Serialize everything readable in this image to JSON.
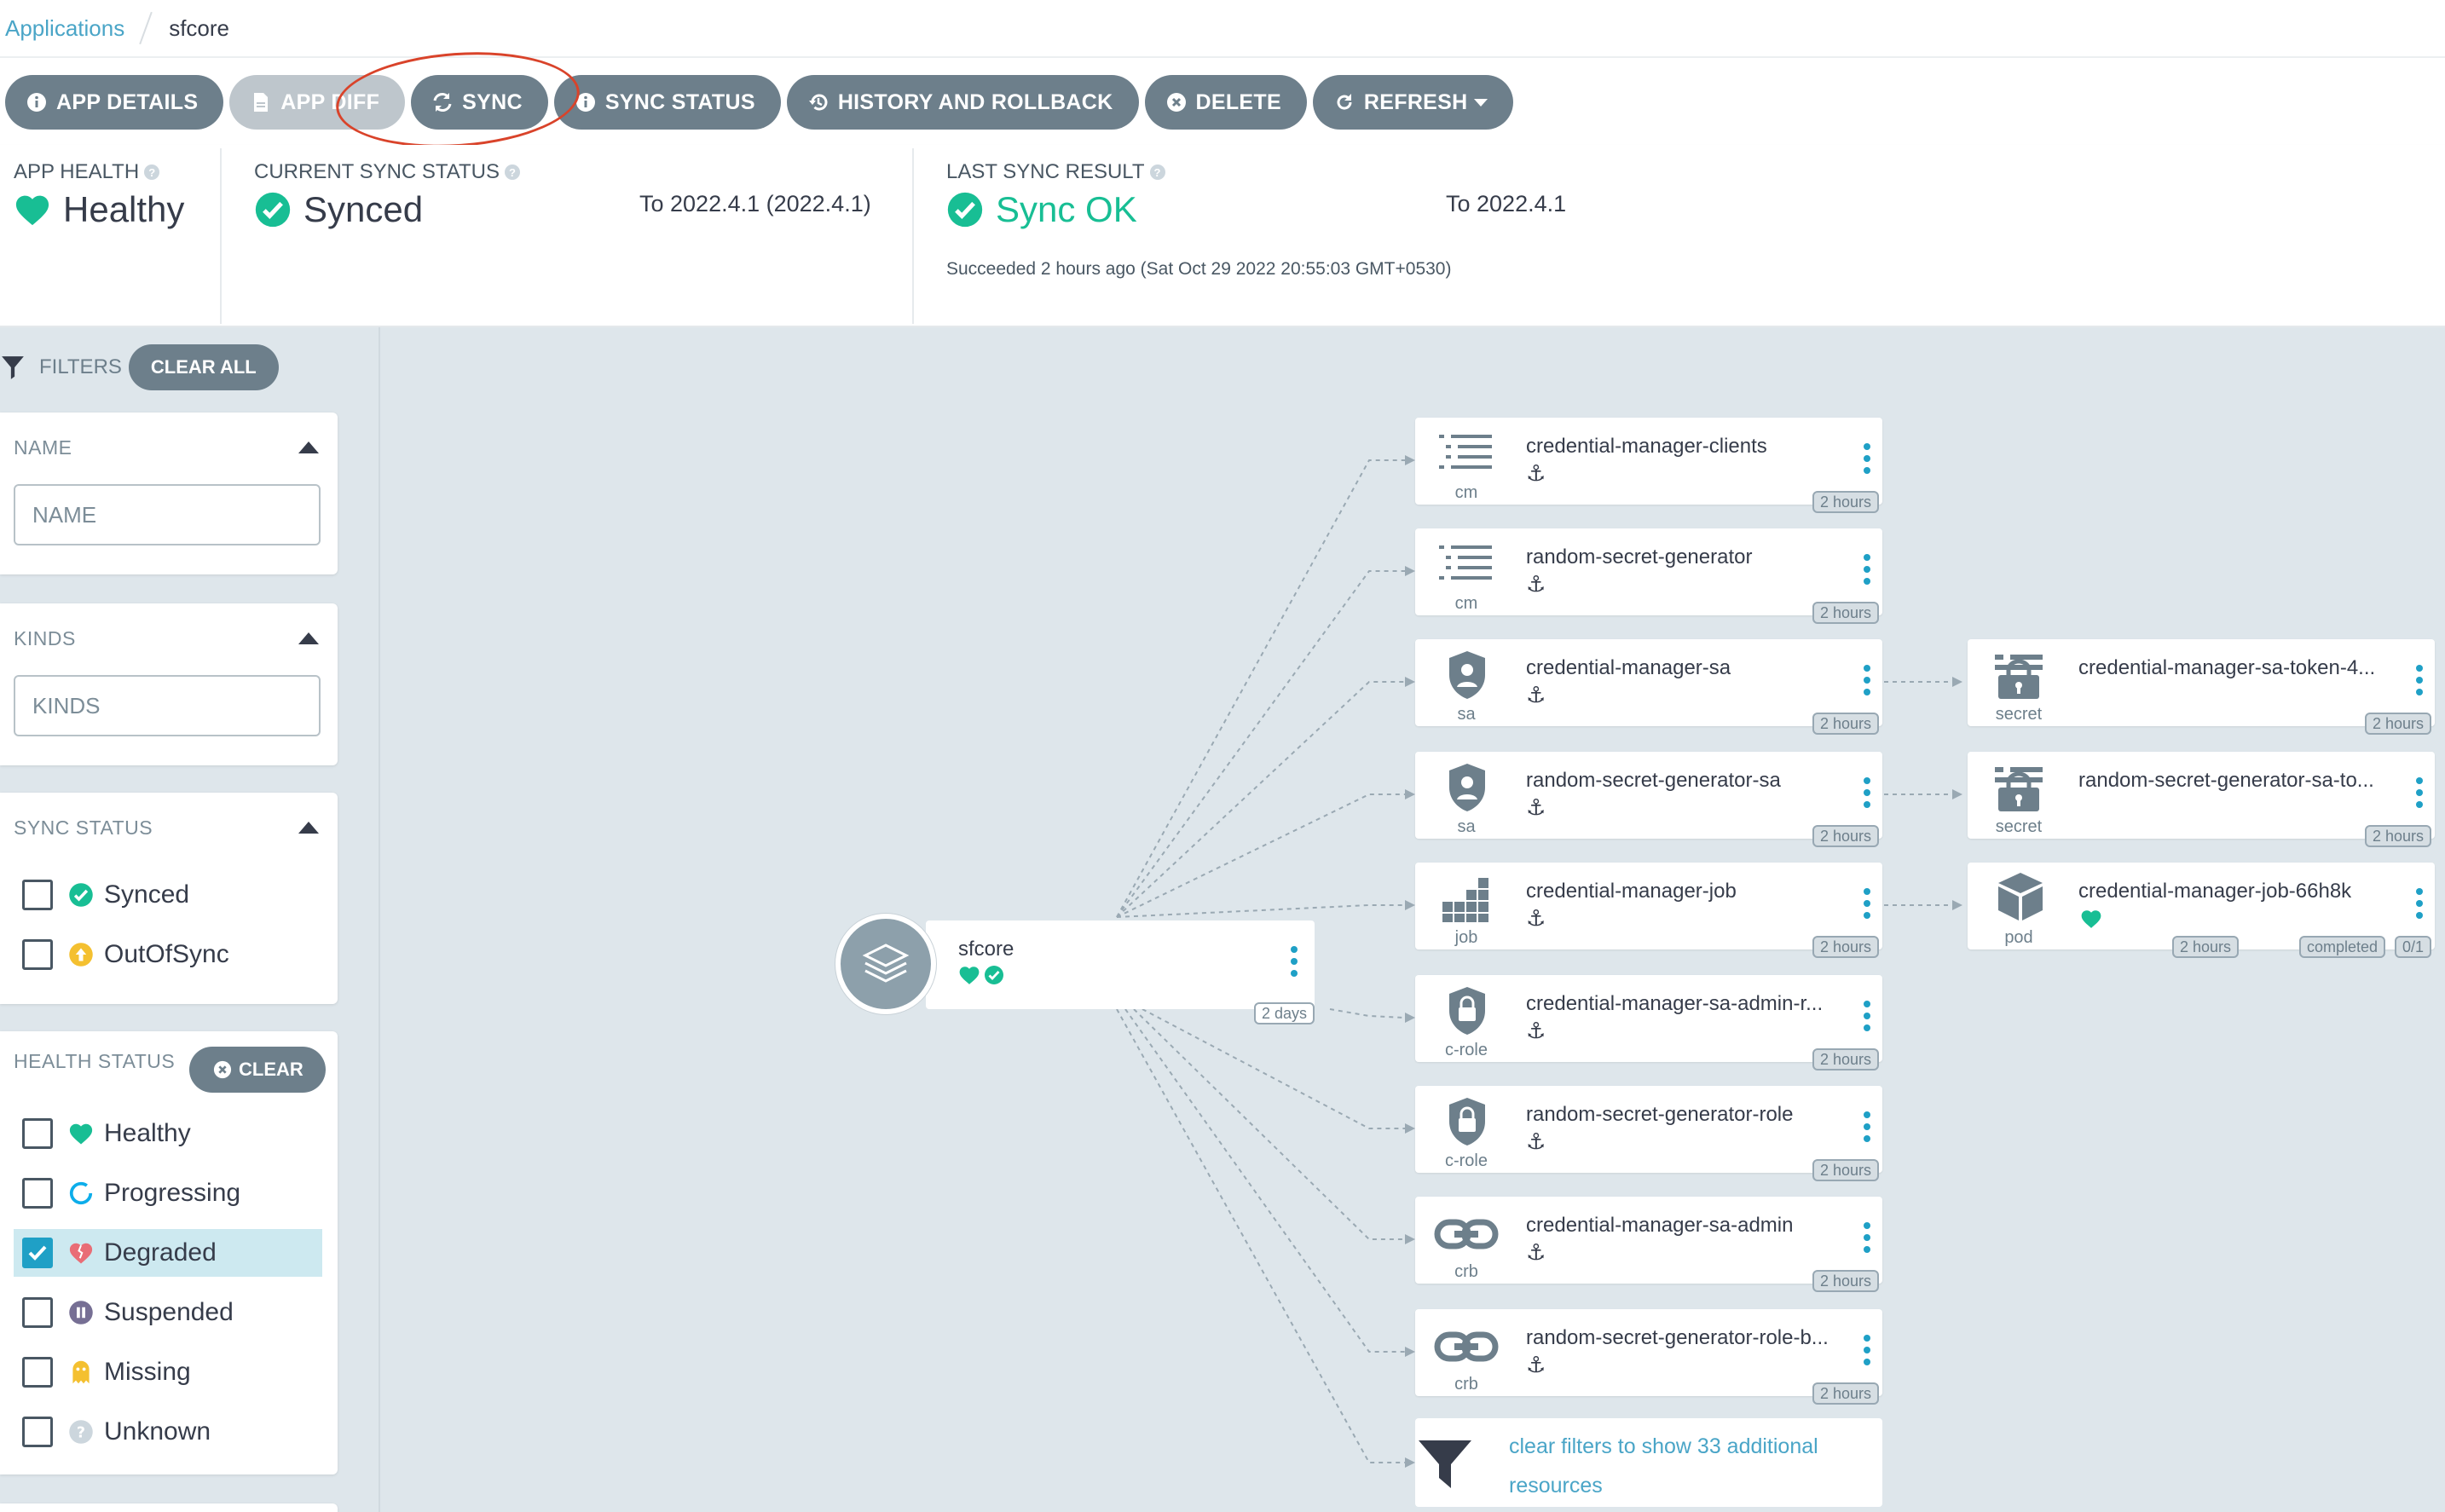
{
  "breadcrumb": {
    "parent": "Applications",
    "current": "sfcore"
  },
  "toolbar": {
    "app_details": "APP DETAILS",
    "app_diff": "APP DIFF",
    "sync": "SYNC",
    "sync_status": "SYNC STATUS",
    "history": "HISTORY AND ROLLBACK",
    "delete": "DELETE",
    "refresh": "REFRESH"
  },
  "status": {
    "health_label": "APP HEALTH",
    "health_value": "Healthy",
    "sync_label": "CURRENT SYNC STATUS",
    "sync_value": "Synced",
    "sync_target": "To 2022.4.1 (2022.4.1)",
    "last_label": "LAST SYNC RESULT",
    "last_value": "Sync OK",
    "last_target": "To 2022.4.1",
    "last_detail": "Succeeded 2 hours ago (Sat Oct 29 2022 20:55:03 GMT+0530)"
  },
  "filters": {
    "label": "FILTERS",
    "clear_all": "CLEAR ALL",
    "name_title": "NAME",
    "name_placeholder": "NAME",
    "kinds_title": "KINDS",
    "kinds_placeholder": "KINDS",
    "sync_title": "SYNC STATUS",
    "sync_options": [
      "Synced",
      "OutOfSync"
    ],
    "health_title": "HEALTH STATUS",
    "health_clear": "CLEAR",
    "health_options": [
      "Healthy",
      "Progressing",
      "Degraded",
      "Suspended",
      "Missing",
      "Unknown"
    ],
    "health_checked": "Degraded"
  },
  "root": {
    "name": "sfcore",
    "age": "2 days"
  },
  "nodes": [
    {
      "name": "credential-manager-clients",
      "kind": "cm",
      "age": "2 hours"
    },
    {
      "name": "random-secret-generator",
      "kind": "cm",
      "age": "2 hours"
    },
    {
      "name": "credential-manager-sa",
      "kind": "sa",
      "age": "2 hours"
    },
    {
      "name": "random-secret-generator-sa",
      "kind": "sa",
      "age": "2 hours"
    },
    {
      "name": "credential-manager-job",
      "kind": "job",
      "age": "2 hours"
    },
    {
      "name": "credential-manager-sa-admin-r...",
      "kind": "c-role",
      "age": "2 hours"
    },
    {
      "name": "random-secret-generator-role",
      "kind": "c-role",
      "age": "2 hours"
    },
    {
      "name": "credential-manager-sa-admin",
      "kind": "crb",
      "age": "2 hours"
    },
    {
      "name": "random-secret-generator-role-b...",
      "kind": "crb",
      "age": "2 hours"
    }
  ],
  "children": [
    {
      "name": "credential-manager-sa-token-4...",
      "kind": "secret",
      "age": "2 hours"
    },
    {
      "name": "random-secret-generator-sa-to...",
      "kind": "secret",
      "age": "2 hours"
    },
    {
      "name": "credential-manager-job-66h8k",
      "kind": "pod",
      "age": "2 hours",
      "state": "completed",
      "count": "0/1"
    }
  ],
  "more": {
    "text": "clear filters to show 33 additional resources"
  },
  "colors": {
    "accent": "#1fa0c6",
    "healthy": "#18be94",
    "button": "#6d7f8b",
    "degraded": "#e96d76",
    "progressing": "#0dadea",
    "missing": "#f4c030",
    "suspended": "#766f94",
    "outofsync": "#f4c030"
  }
}
